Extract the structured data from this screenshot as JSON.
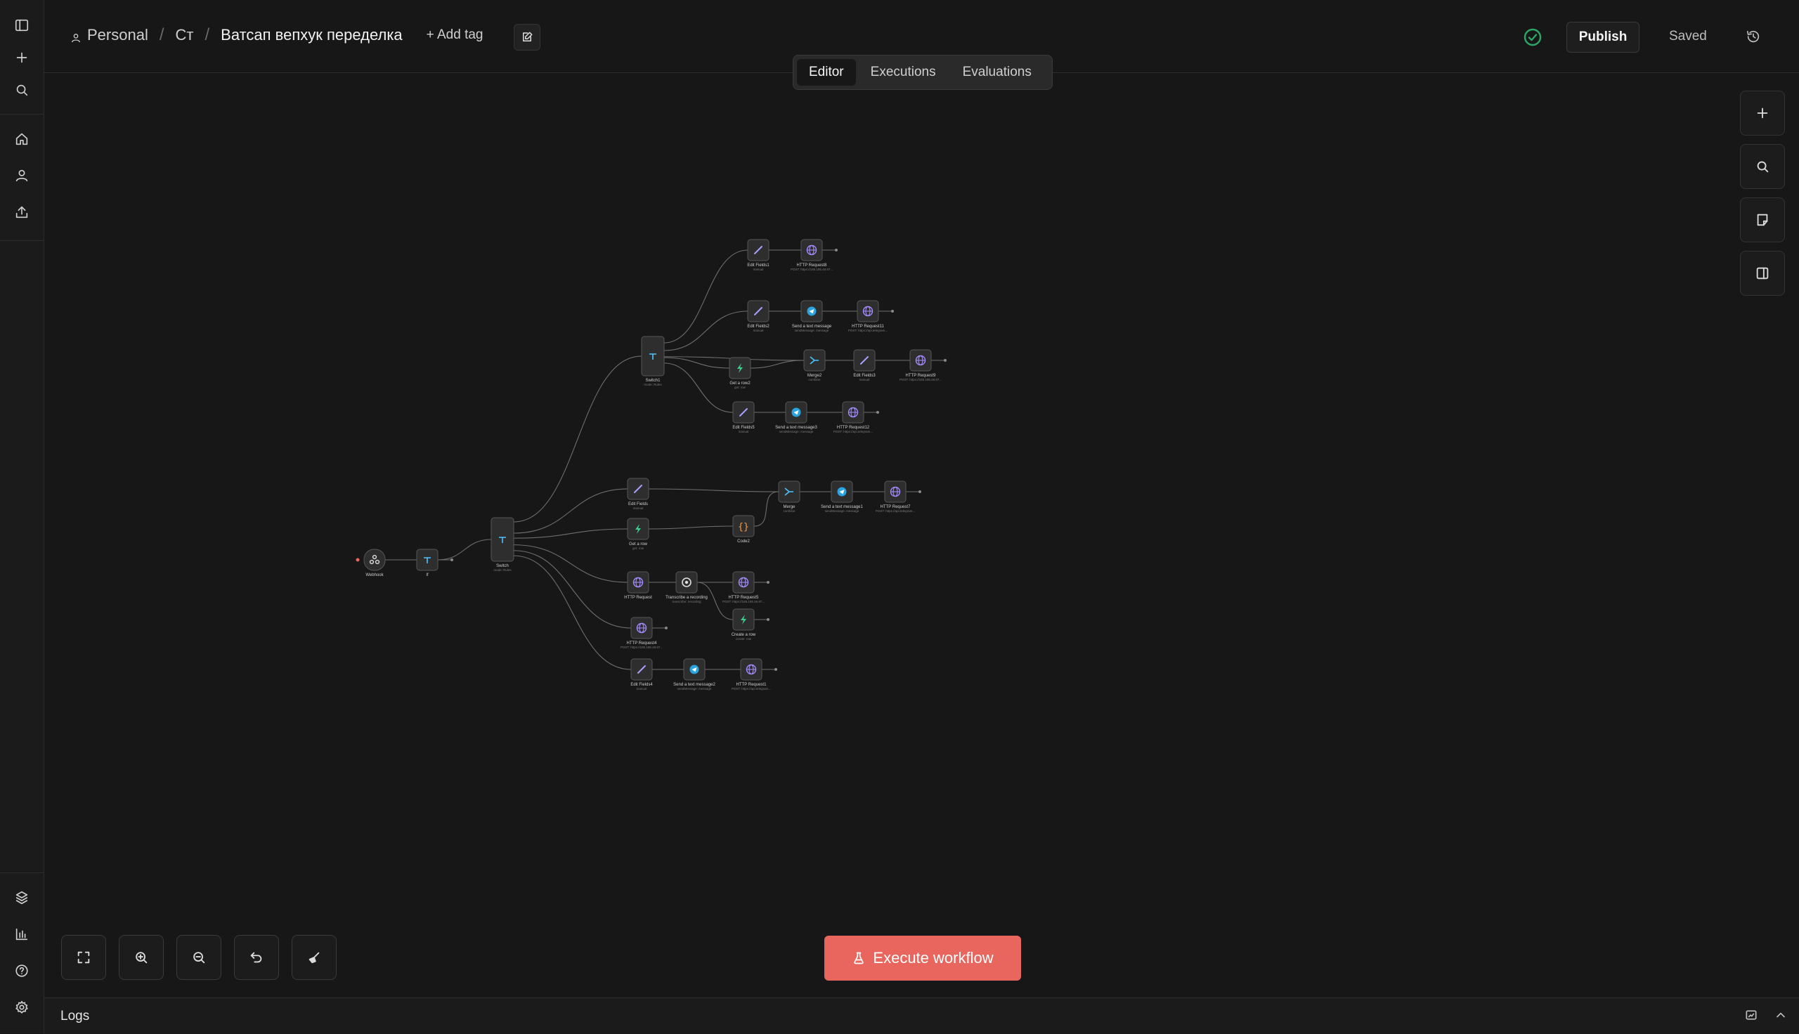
{
  "breadcrumb": {
    "project": "Personal",
    "folder": "Ст",
    "workflow_name": "Ватсап вепхук переделка",
    "add_tag": "+ Add tag"
  },
  "header": {
    "publish_label": "Publish",
    "save_status": "Saved"
  },
  "tabs": [
    {
      "label": "Editor",
      "active": true
    },
    {
      "label": "Executions",
      "active": false
    },
    {
      "label": "Evaluations",
      "active": false
    }
  ],
  "execute_label": "Execute workflow",
  "logs_label": "Logs",
  "colors": {
    "accent": "#e8665d",
    "success": "#2ea665",
    "background": "#171717"
  },
  "sidebar_icons": [
    "panel-toggle-icon",
    "plus-icon",
    "search-icon",
    "home-icon",
    "user-icon",
    "share-icon",
    "templates-icon",
    "insights-icon",
    "help-icon",
    "settings-icon"
  ],
  "nodes": [
    {
      "id": "webhook",
      "label": "Webhook",
      "sub": "",
      "icon": "webhook"
    },
    {
      "id": "if",
      "label": "If",
      "sub": "",
      "icon": "switch"
    },
    {
      "id": "switch",
      "label": "Switch",
      "sub": "mode: Rules",
      "icon": "switch"
    },
    {
      "id": "switch1",
      "label": "Switch1",
      "sub": "mode: Rules",
      "icon": "switch"
    },
    {
      "id": "edit_fields1",
      "label": "Edit Fields1",
      "sub": "manual",
      "icon": "pen"
    },
    {
      "id": "http_req8",
      "label": "HTTP Request8",
      "sub": "POST: https://185.195.48.87...",
      "icon": "globe"
    },
    {
      "id": "edit_fields2",
      "label": "Edit Fields2",
      "sub": "manual",
      "icon": "pen"
    },
    {
      "id": "send_text",
      "label": "Send a text message",
      "sub": "sendMessage: message",
      "icon": "telegram"
    },
    {
      "id": "http_req11",
      "label": "HTTP Request11",
      "sub": "POST: https://api.telegram...",
      "icon": "globe"
    },
    {
      "id": "get_row2",
      "label": "Get a row2",
      "sub": "get: row",
      "icon": "bolt"
    },
    {
      "id": "merge2",
      "label": "Merge2",
      "sub": "combine",
      "icon": "merge"
    },
    {
      "id": "edit_fields3",
      "label": "Edit Fields3",
      "sub": "manual",
      "icon": "pen"
    },
    {
      "id": "http_req9",
      "label": "HTTP Request9",
      "sub": "POST: https://185.195.48.87...",
      "icon": "globe"
    },
    {
      "id": "edit_fields5",
      "label": "Edit Fields5",
      "sub": "manual",
      "icon": "pen"
    },
    {
      "id": "send_text3",
      "label": "Send a text message3",
      "sub": "sendMessage: message",
      "icon": "telegram"
    },
    {
      "id": "http_req12",
      "label": "HTTP Request12",
      "sub": "POST: https://api.telegram...",
      "icon": "globe"
    },
    {
      "id": "edit_fields",
      "label": "Edit Fields",
      "sub": "manual",
      "icon": "pen"
    },
    {
      "id": "merge",
      "label": "Merge",
      "sub": "combine",
      "icon": "merge"
    },
    {
      "id": "send_text1",
      "label": "Send a text message1",
      "sub": "sendMessage: message",
      "icon": "telegram"
    },
    {
      "id": "http_req7",
      "label": "HTTP Request7",
      "sub": "POST: https://api.telegram...",
      "icon": "globe"
    },
    {
      "id": "get_row",
      "label": "Get a row",
      "sub": "get: row",
      "icon": "bolt"
    },
    {
      "id": "code2",
      "label": "Code2",
      "sub": "",
      "icon": "code"
    },
    {
      "id": "http_req",
      "label": "HTTP Request",
      "sub": "",
      "icon": "globe"
    },
    {
      "id": "transcribe",
      "label": "Transcribe a recording",
      "sub": "transcribe: recording",
      "icon": "openai"
    },
    {
      "id": "http_req5",
      "label": "HTTP Request5",
      "sub": "POST: https://185.195.48.87...",
      "icon": "globe"
    },
    {
      "id": "create_row",
      "label": "Create a row",
      "sub": "create: row",
      "icon": "bolt"
    },
    {
      "id": "http_req4",
      "label": "HTTP Request4",
      "sub": "POST: https://185.195.48.87...",
      "icon": "globe"
    },
    {
      "id": "edit_fields4",
      "label": "Edit Fields4",
      "sub": "manual",
      "icon": "pen"
    },
    {
      "id": "send_text2",
      "label": "Send a text message2",
      "sub": "sendMessage: message",
      "icon": "telegram"
    },
    {
      "id": "http_req1",
      "label": "HTTP Request1",
      "sub": "POST: https://api.telegram...",
      "icon": "globe"
    }
  ],
  "edges": [
    [
      "webhook",
      "if"
    ],
    [
      "if",
      "switch"
    ],
    [
      "switch",
      "switch1"
    ],
    [
      "switch",
      "edit_fields"
    ],
    [
      "switch",
      "get_row"
    ],
    [
      "switch",
      "http_req"
    ],
    [
      "switch",
      "http_req4"
    ],
    [
      "switch",
      "edit_fields4"
    ],
    [
      "switch1",
      "edit_fields1"
    ],
    [
      "switch1",
      "edit_fields2"
    ],
    [
      "switch1",
      "get_row2"
    ],
    [
      "switch1",
      "merge2"
    ],
    [
      "switch1",
      "edit_fields5"
    ],
    [
      "edit_fields1",
      "http_req8"
    ],
    [
      "edit_fields2",
      "send_text"
    ],
    [
      "send_text",
      "http_req11"
    ],
    [
      "get_row2",
      "merge2"
    ],
    [
      "merge2",
      "edit_fields3"
    ],
    [
      "edit_fields3",
      "http_req9"
    ],
    [
      "edit_fields5",
      "send_text3"
    ],
    [
      "send_text3",
      "http_req12"
    ],
    [
      "edit_fields",
      "merge"
    ],
    [
      "get_row",
      "code2"
    ],
    [
      "code2",
      "merge"
    ],
    [
      "merge",
      "send_text1"
    ],
    [
      "send_text1",
      "http_req7"
    ],
    [
      "http_req",
      "transcribe"
    ],
    [
      "transcribe",
      "http_req5"
    ],
    [
      "transcribe",
      "create_row"
    ],
    [
      "edit_fields4",
      "send_text2"
    ],
    [
      "send_text2",
      "http_req1"
    ]
  ]
}
